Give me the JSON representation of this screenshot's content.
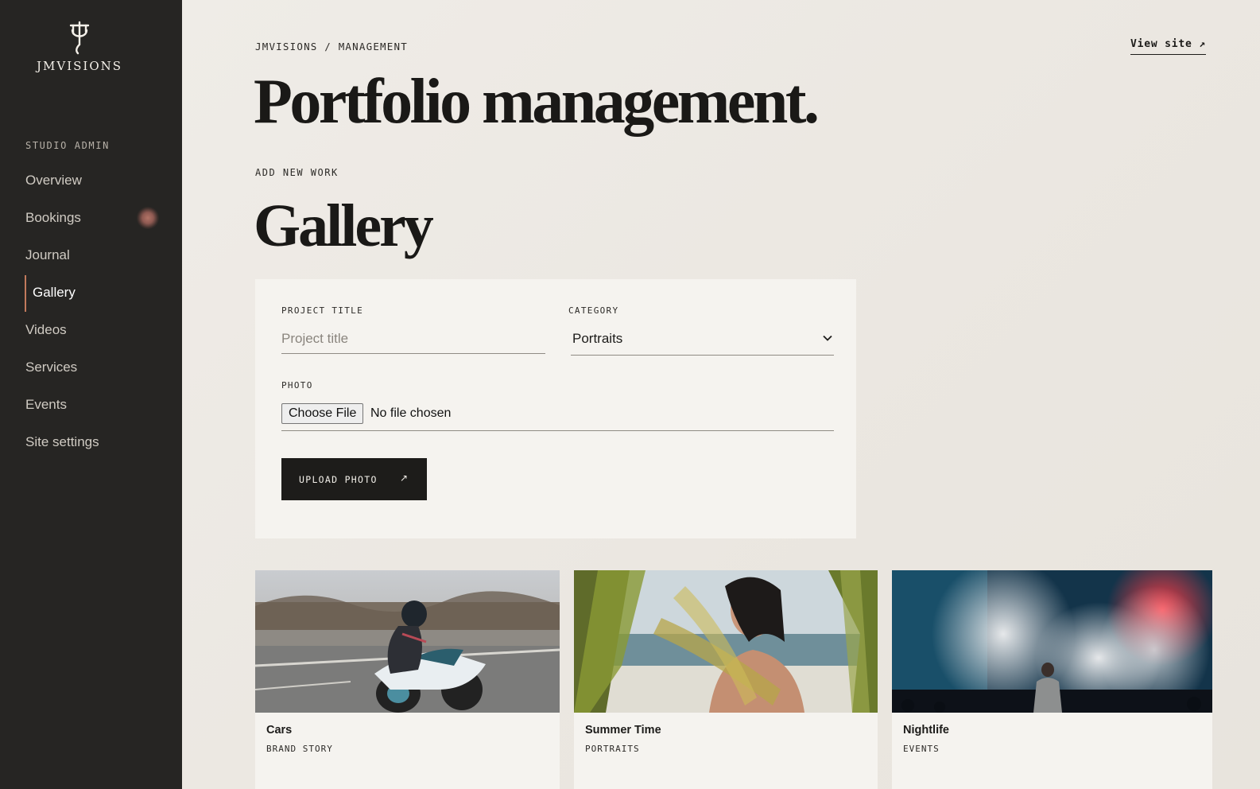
{
  "brand": {
    "name": "JMVISIONS"
  },
  "sidebar": {
    "section_label": "STUDIO ADMIN",
    "items": [
      {
        "label": "Overview"
      },
      {
        "label": "Bookings"
      },
      {
        "label": "Journal"
      },
      {
        "label": "Gallery"
      },
      {
        "label": "Videos"
      },
      {
        "label": "Services"
      },
      {
        "label": "Events"
      },
      {
        "label": "Site settings"
      }
    ],
    "active_item": "Gallery",
    "notification_item": "Bookings"
  },
  "header": {
    "breadcrumb": "JMVISIONS / MANAGEMENT",
    "view_site": "View site ↗",
    "title": "Portfolio management."
  },
  "section": {
    "label": "ADD NEW WORK",
    "title": "Gallery"
  },
  "form": {
    "project_title_label": "PROJECT TITLE",
    "project_title_placeholder": "Project title",
    "project_title_value": "",
    "category_label": "CATEGORY",
    "category_value": "Portraits",
    "photo_label": "PHOTO",
    "file_button": "Choose File",
    "file_status": "No file chosen",
    "upload_button": "UPLOAD PHOTO",
    "upload_arrow": "↗"
  },
  "gallery": [
    {
      "title": "Cars",
      "category": "BRAND STORY"
    },
    {
      "title": "Summer Time",
      "category": "PORTRAITS"
    },
    {
      "title": "Nightlife",
      "category": "EVENTS"
    }
  ],
  "colors": {
    "sidebar_bg": "#262523",
    "page_bg": "#ece8e2",
    "card_bg": "#f5f3ef",
    "accent": "#c27a5c",
    "button_bg": "#1d1c1a"
  }
}
